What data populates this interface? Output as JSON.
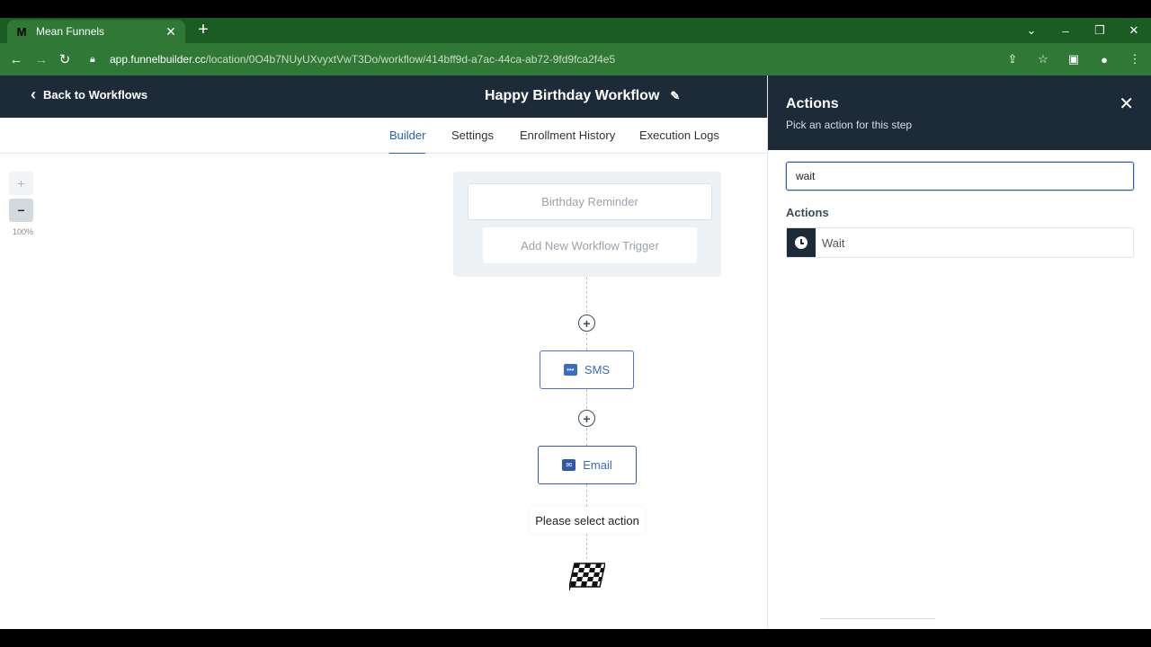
{
  "browser": {
    "tab_title": "Mean Funnels",
    "favicon_letter": "M",
    "url_host": "app.funnelbuilder.cc",
    "url_path": "/location/0O4b7NUyUXvyxtVwT3Do/workflow/414bff9d-a7ac-44ca-ab72-9fd9fca2f4e5"
  },
  "header": {
    "back_label": "Back to Workflows",
    "workflow_title": "Happy Birthday Workflow"
  },
  "tabs": [
    {
      "label": "Builder",
      "active": true
    },
    {
      "label": "Settings"
    },
    {
      "label": "Enrollment History"
    },
    {
      "label": "Execution Logs"
    }
  ],
  "canvas": {
    "zoom_in": "+",
    "zoom_out": "−",
    "zoom_level": "100%",
    "triggers": [
      "Birthday Reminder",
      "Add New Workflow Trigger"
    ],
    "nodes": [
      {
        "label": "SMS",
        "icon": "message-icon"
      },
      {
        "label": "Email",
        "icon": "envelope-icon"
      }
    ],
    "placeholder": "Please select action"
  },
  "panel": {
    "title": "Actions",
    "subtitle": "Pick an action for this step",
    "search_value": "wait",
    "section_label": "Actions",
    "results": [
      {
        "label": "Wait",
        "icon": "clock-icon"
      }
    ]
  },
  "colors": {
    "header_bg": "#1d2b39",
    "accent": "#2b5fb4",
    "browser_green": "#2f7836"
  }
}
